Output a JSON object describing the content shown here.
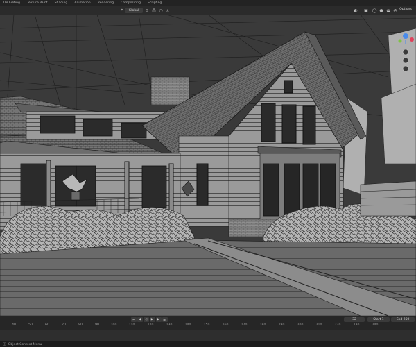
{
  "workspace_tabs": [
    "UV Editing",
    "Texture Paint",
    "Shading",
    "Animation",
    "Rendering",
    "Compositing",
    "Scripting"
  ],
  "header": {
    "transform_orientation": "Global",
    "options_label": "Options"
  },
  "timeline": {
    "current_frame": "32",
    "start_label": "Start",
    "start_value": "1",
    "end_label": "End",
    "end_value": "250",
    "ticks": [
      "40",
      "50",
      "60",
      "70",
      "80",
      "90",
      "100",
      "110",
      "120",
      "130",
      "140",
      "150",
      "160",
      "170",
      "180",
      "190",
      "200",
      "210",
      "220",
      "230",
      "240"
    ]
  },
  "statusbar": {
    "context_menu_label": "Object Context Menu"
  },
  "colors": {
    "viewport_bg": "#3a3a3a",
    "wire": "#141414",
    "gizmo_x": "#e0425c",
    "gizmo_y": "#7fc242",
    "gizmo_z": "#4a8bea"
  },
  "icons": [
    "transform-orientation-icon",
    "pivot-icon",
    "snap-icon",
    "proportional-icon",
    "overlay-icon",
    "shading-wireframe-icon",
    "shading-solid-icon",
    "gizmo-icon",
    "play-icon",
    "jump-end-icon",
    "jump-start-icon"
  ]
}
